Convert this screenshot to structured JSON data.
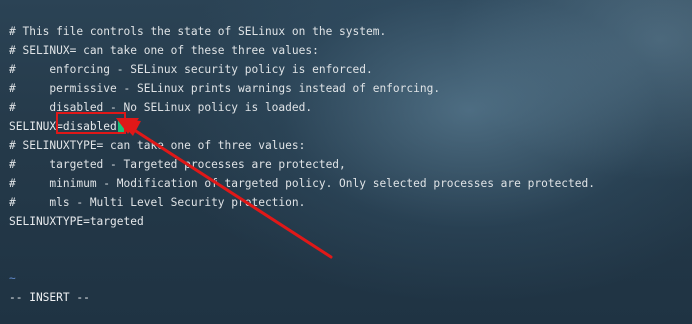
{
  "editor": {
    "lines": [
      "# This file controls the state of SELinux on the system.",
      "# SELINUX= can take one of these three values:",
      "#     enforcing - SELinux security policy is enforced.",
      "#     permissive - SELinux prints warnings instead of enforcing.",
      "#     disabled - No SELinux policy is loaded.",
      "SELINUX=disabled",
      "# SELINUXTYPE= can take one of three values:",
      "#     targeted - Targeted processes are protected,",
      "#     minimum - Modification of targeted policy. Only selected processes are protected.",
      "#     mls - Multi Level Security protection.",
      "SELINUXTYPE=targeted",
      "",
      "",
      "~"
    ]
  },
  "status": {
    "mode": "-- INSERT --"
  },
  "colors": {
    "cursor": "#19c37a",
    "annotation": "#e01818",
    "tilde": "#5f88c8"
  }
}
